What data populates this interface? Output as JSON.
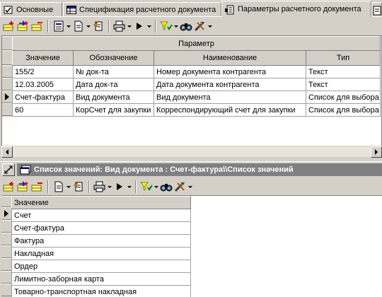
{
  "tabs": [
    {
      "label": "Основные",
      "icon": "tab-check-icon",
      "active": false
    },
    {
      "label": "Спецификация расчетного документа",
      "icon": "table-icon",
      "active": false
    },
    {
      "label": "Параметры расчетного документа",
      "icon": "document-params-icon",
      "active": true
    },
    {
      "label": "",
      "icon": "document-icon",
      "active": false
    }
  ],
  "toolbar_icons": [
    "add-row-icon",
    "insert-row-icon",
    "delete-row-icon",
    "properties-icon",
    "document-icon",
    "refresh-icon",
    "print-icon",
    "run-icon",
    "filter-icon",
    "find-icon",
    "tools-icon"
  ],
  "params_grid": {
    "group_header": "Параметр",
    "columns": [
      "Значение",
      "Обозначение",
      "Наименование",
      "Тип"
    ],
    "rows": [
      [
        "155/2",
        "№ док-та",
        "Номер документа контрагента",
        "Текст"
      ],
      [
        "12.03.2005",
        "Дата док-та",
        "Дата документа контрагента",
        "Текст"
      ],
      [
        "Счет-фактура",
        "Вид документа",
        "Вид документа",
        "Список для выбора"
      ],
      [
        "60",
        "КорСчет для закупки",
        "Корреспондирующий счет для закупки",
        "Список для выбора"
      ]
    ],
    "current_row": 2
  },
  "values_panel": {
    "title": "Список значений: Вид документа : Счет-фактура\\\\Список значений"
  },
  "values_grid": {
    "column": "Значение",
    "rows": [
      "Счет",
      "Счет-фактура",
      "Фактура",
      "Накладная",
      "Ордер",
      "Лимитно-заборная карта",
      "Товарно-транспортная накладная"
    ],
    "current_row": 0
  }
}
